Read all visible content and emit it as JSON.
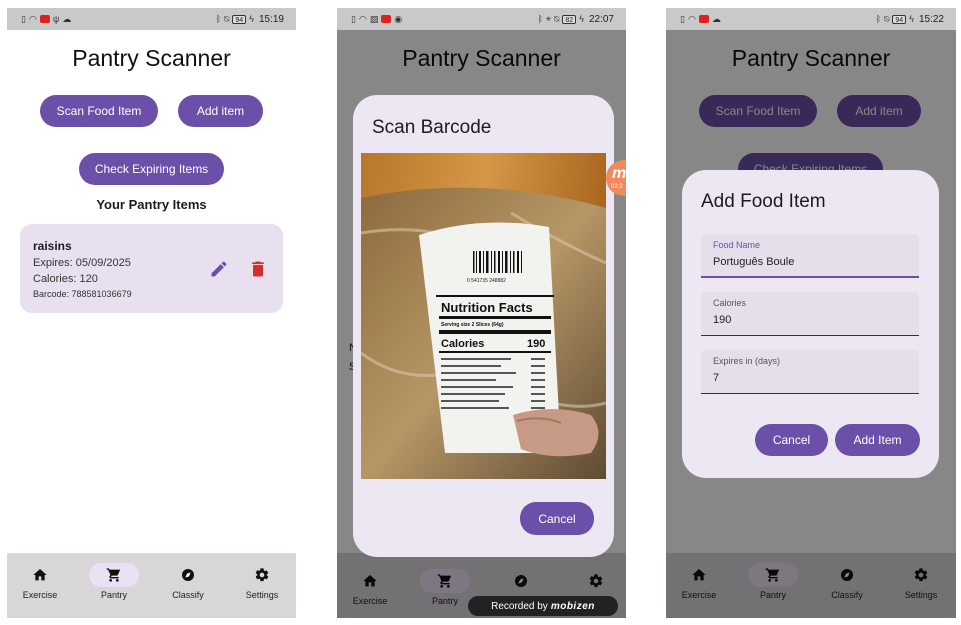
{
  "colors": {
    "primary": "#6b4fa8",
    "card_bg": "#e8e0ef",
    "dialog_bg": "#ede7f3",
    "delete": "#d32f2f",
    "navbar_bg": "#d9d6da",
    "nav_active": "#ece0f5"
  },
  "app": {
    "title": "Pantry Scanner",
    "scan_button": "Scan Food Item",
    "add_button": "Add item",
    "check_button": "Check Expiring Items",
    "section_title": "Your Pantry Items"
  },
  "pantry_item": {
    "name": "raisins",
    "expires": "Expires: 05/09/2025",
    "calories": "Calories: 120",
    "barcode": "Barcode: 788581036679",
    "edit_icon": "pencil-icon",
    "delete_icon": "trash-icon"
  },
  "nav": [
    {
      "label": "Exercise",
      "icon": "home-icon"
    },
    {
      "label": "Pantry",
      "icon": "cart-icon"
    },
    {
      "label": "Classify",
      "icon": "compass-icon"
    },
    {
      "label": "Settings",
      "icon": "gear-icon"
    }
  ],
  "screens": [
    {
      "status": {
        "battery": "94",
        "time": "15:19"
      }
    },
    {
      "status": {
        "battery": "82",
        "time": "22:07"
      },
      "dialog": {
        "title": "Scan Barcode",
        "cancel": "Cancel"
      },
      "overlay": {
        "recorded_by": "Recorded by",
        "brand": "mobizen",
        "bubble_letter": "m",
        "bubble_time": "02:2"
      },
      "label_text": {
        "heading": "Nutrition Facts",
        "calories_label": "Calories",
        "calories_value": "190",
        "barcode_digits": "0 541735 248882",
        "serving": "Serving size  2 Slices (64g)"
      }
    },
    {
      "status": {
        "battery": "94",
        "time": "15:22"
      },
      "dialog": {
        "title": "Add Food Item",
        "fields": [
          {
            "label": "Food Name",
            "value": "Português Boule"
          },
          {
            "label": "Calories",
            "value": "190"
          },
          {
            "label": "Expires in (days)",
            "value": "7"
          }
        ],
        "cancel": "Cancel",
        "submit": "Add Item"
      }
    }
  ]
}
